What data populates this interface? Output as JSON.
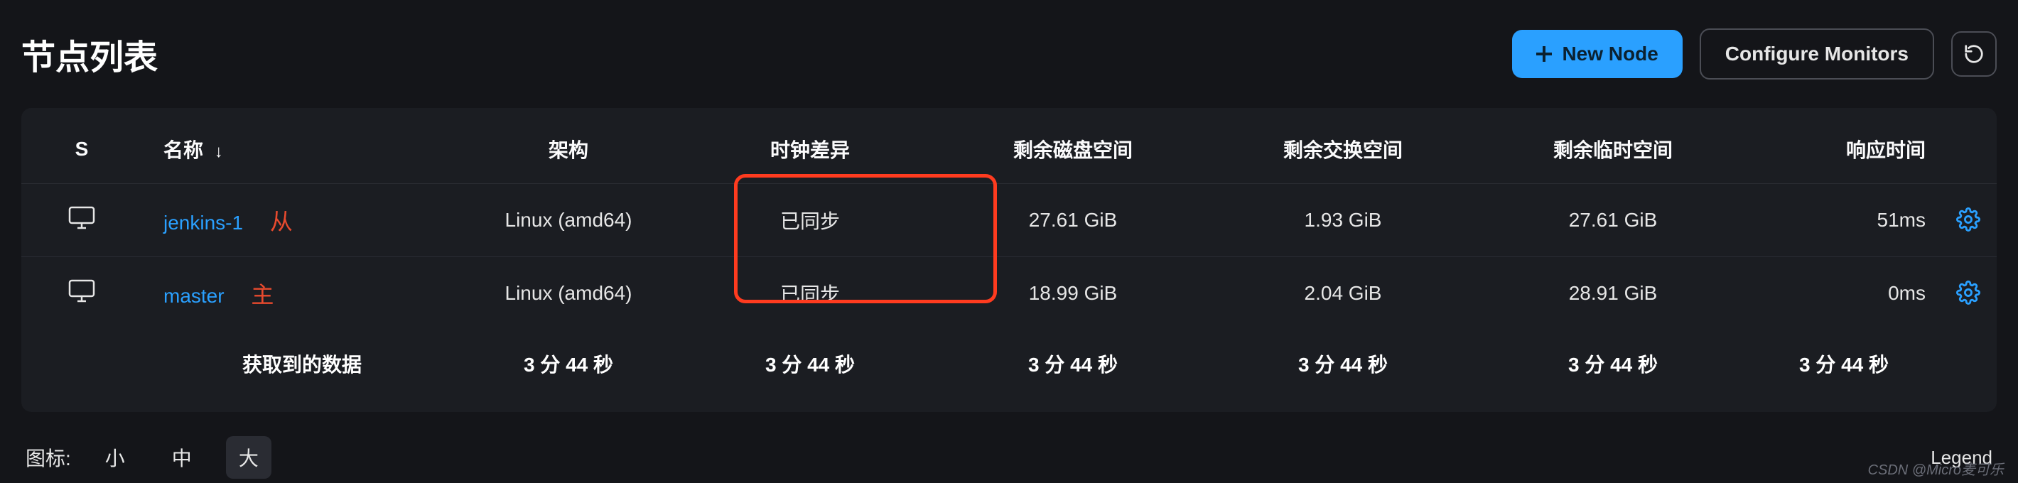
{
  "header": {
    "title": "节点列表",
    "new_node": "New Node",
    "configure_monitors": "Configure Monitors"
  },
  "columns": {
    "s": "S",
    "name": "名称",
    "arch": "架构",
    "clock": "时钟差异",
    "disk": "剩余磁盘空间",
    "swap": "剩余交换空间",
    "temp": "剩余临时空间",
    "resp": "响应时间"
  },
  "rows": [
    {
      "name": "jenkins-1",
      "tag": "从",
      "arch": "Linux (amd64)",
      "clock": "已同步",
      "disk": "27.61 GiB",
      "swap": "1.93 GiB",
      "temp": "27.61 GiB",
      "resp": "51ms"
    },
    {
      "name": "master",
      "tag": "主",
      "arch": "Linux (amd64)",
      "clock": "已同步",
      "disk": "18.99 GiB",
      "swap": "2.04 GiB",
      "temp": "28.91 GiB",
      "resp": "0ms"
    }
  ],
  "footer_row": {
    "label": "获取到的数据",
    "arch": "3 分 44 秒",
    "clock": "3 分 44 秒",
    "disk": "3 分 44 秒",
    "swap": "3 分 44 秒",
    "temp": "3 分 44 秒",
    "resp": "3 分 44 秒"
  },
  "bottom": {
    "label": "图标:",
    "small": "小",
    "medium": "中",
    "large": "大",
    "legend": "Legend"
  },
  "watermark": "CSDN @Micro麦可乐",
  "colors": {
    "accent": "#2aa0ff",
    "danger": "#e84a2e",
    "highlight": "#ff3b1f"
  }
}
